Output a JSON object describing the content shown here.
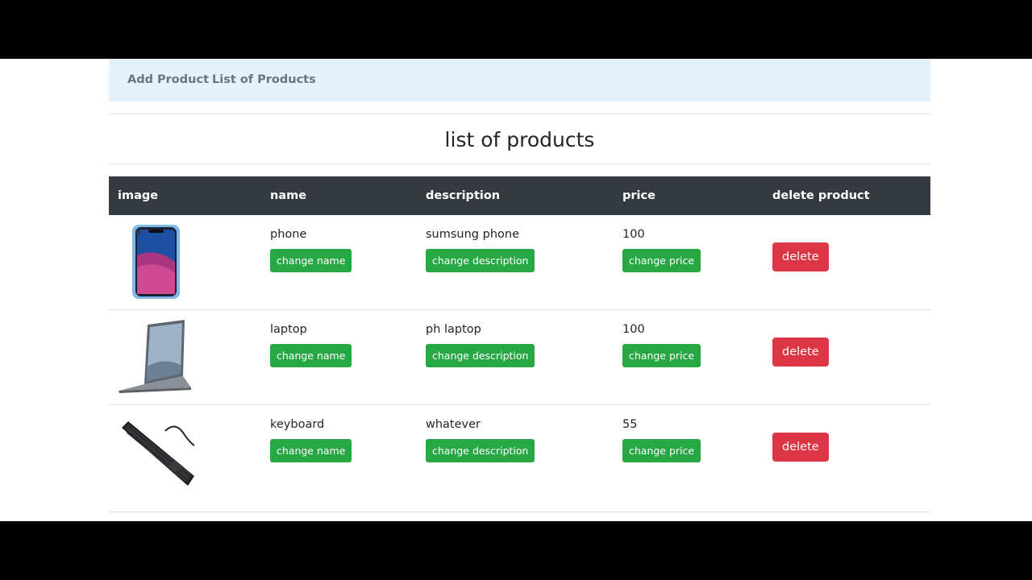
{
  "nav": {
    "add_product": "Add Product",
    "list_products": "List of Products"
  },
  "page_title": "list of products",
  "table": {
    "headers": [
      "image",
      "name",
      "description",
      "price",
      "delete product"
    ],
    "rows": [
      {
        "image_icon": "phone-image",
        "name": "phone",
        "description": "sumsung phone",
        "price": "100"
      },
      {
        "image_icon": "laptop-image",
        "name": "laptop",
        "description": "ph laptop",
        "price": "100"
      },
      {
        "image_icon": "keyboard-image",
        "name": "keyboard",
        "description": "whatever",
        "price": "55"
      }
    ]
  },
  "buttons": {
    "change_name": "change name",
    "change_description": "change description",
    "change_price": "change price",
    "delete": "delete"
  },
  "colors": {
    "navbar_bg": "#e3f2fd",
    "table_head_bg": "#343a40",
    "success": "#28a745",
    "danger": "#dc3545"
  }
}
